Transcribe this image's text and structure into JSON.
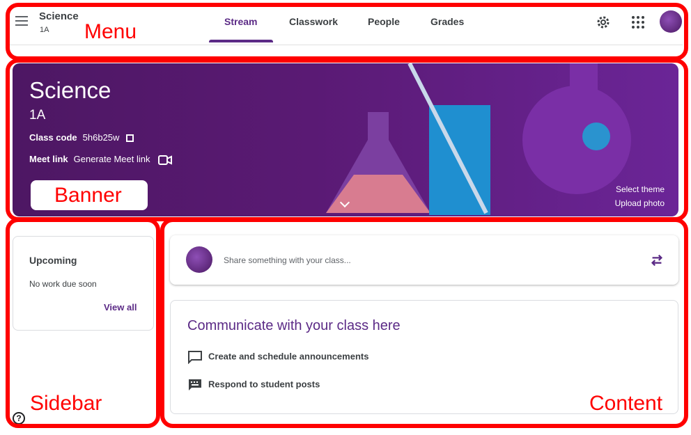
{
  "header": {
    "class_name": "Science",
    "class_section": "1A",
    "tabs": [
      {
        "label": "Stream",
        "active": true
      },
      {
        "label": "Classwork",
        "active": false
      },
      {
        "label": "People",
        "active": false
      },
      {
        "label": "Grades",
        "active": false
      }
    ],
    "icons": [
      "menu-icon",
      "gear-icon",
      "apps-grid-icon",
      "avatar"
    ]
  },
  "banner": {
    "title": "Science",
    "section": "1A",
    "class_code_label": "Class code",
    "class_code_value": "5h6b25w",
    "meet_label": "Meet link",
    "meet_value": "Generate Meet link",
    "select_theme": "Select theme",
    "upload_photo": "Upload photo"
  },
  "sidebar": {
    "upcoming_title": "Upcoming",
    "upcoming_text": "No work due soon",
    "view_all": "View all"
  },
  "main": {
    "share_placeholder": "Share something with your class...",
    "communicate_title": "Communicate with your class here",
    "items": [
      "Create and schedule announcements",
      "Respond to student posts"
    ]
  },
  "annotations": {
    "menu": "Menu",
    "banner": "Banner",
    "sidebar": "Sidebar",
    "content": "Content"
  },
  "colors": {
    "accent": "#5b2a86",
    "annotation": "#ff0000",
    "banner_bg": "#4d1763"
  }
}
